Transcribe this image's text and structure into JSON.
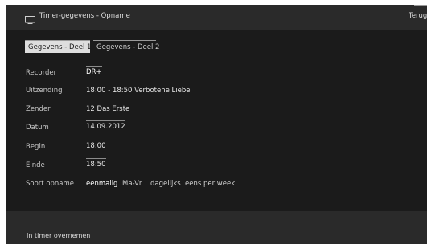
{
  "header": {
    "title": "Timer-gegevens - Opname",
    "back_label": "Terug"
  },
  "tabs": [
    {
      "label": "Gegevens - Deel 1",
      "active": true
    },
    {
      "label": "Gegevens - Deel 2",
      "active": false
    }
  ],
  "fields": {
    "recorder": {
      "label": "Recorder",
      "value": "DR+"
    },
    "broadcast": {
      "label": "Uitzending",
      "value": "18:00 - 18:50 Verbotene Liebe"
    },
    "channel": {
      "label": "Zender",
      "value": "12 Das Erste"
    },
    "date": {
      "label": "Datum",
      "value": "14.09.2012"
    },
    "start": {
      "label": "Begin",
      "value": "18:00"
    },
    "end": {
      "label": "Einde",
      "value": "18:50"
    },
    "recording_type": {
      "label": "Soort opname",
      "options": [
        "eenmalig",
        "Ma-Vr",
        "dagelijks",
        "eens per week"
      ],
      "selected": "eenmalig"
    }
  },
  "footer": {
    "action_label": "In timer overnemen"
  },
  "icons": {
    "header_icon": "tv-icon"
  }
}
